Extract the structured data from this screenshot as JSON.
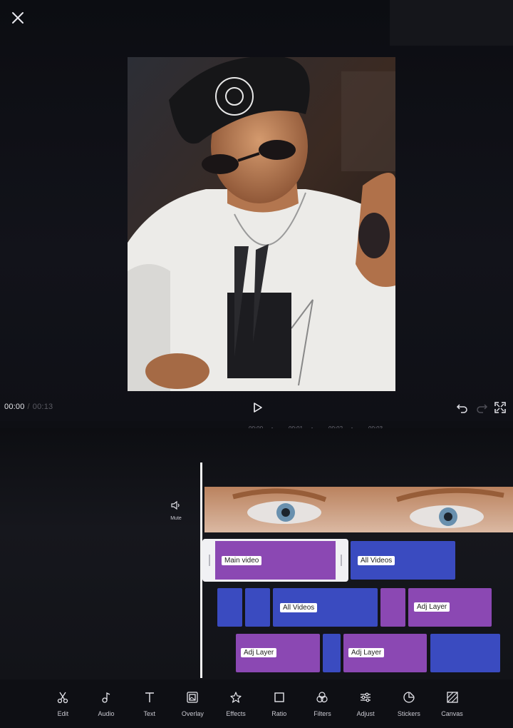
{
  "header": {
    "close_icon": "close-icon"
  },
  "player": {
    "current_time": "00:00",
    "separator": "/",
    "total_time": "00:13",
    "play_icon": "play-icon",
    "undo_icon": "undo-icon",
    "redo_icon": "redo-icon",
    "fullscreen_icon": "fullscreen-icon"
  },
  "ruler": {
    "marks": [
      "00:00",
      "00:01",
      "00:02",
      "00:03"
    ]
  },
  "timeline": {
    "mute_label": "Mute",
    "clips": {
      "main_video": "Main video",
      "all_videos_1": "All Videos",
      "all_videos_2": "All Videos",
      "adj_layer_1": "Adj Layer",
      "adj_layer_2": "Adj Layer",
      "adj_layer_3": "Adj Layer"
    }
  },
  "toolbar": {
    "items": [
      {
        "label": "Edit",
        "icon": "scissors-icon"
      },
      {
        "label": "Audio",
        "icon": "music-note-icon"
      },
      {
        "label": "Text",
        "icon": "text-icon"
      },
      {
        "label": "Overlay",
        "icon": "overlay-icon"
      },
      {
        "label": "Effects",
        "icon": "effects-star-icon"
      },
      {
        "label": "Ratio",
        "icon": "ratio-icon"
      },
      {
        "label": "Filters",
        "icon": "filters-icon"
      },
      {
        "label": "Adjust",
        "icon": "adjust-sliders-icon"
      },
      {
        "label": "Stickers",
        "icon": "sticker-icon"
      },
      {
        "label": "Canvas",
        "icon": "canvas-icon"
      }
    ]
  },
  "colors": {
    "clip_purple": "#8b48b3",
    "clip_blue": "#3a4bc0",
    "background": "#0e0f14"
  }
}
